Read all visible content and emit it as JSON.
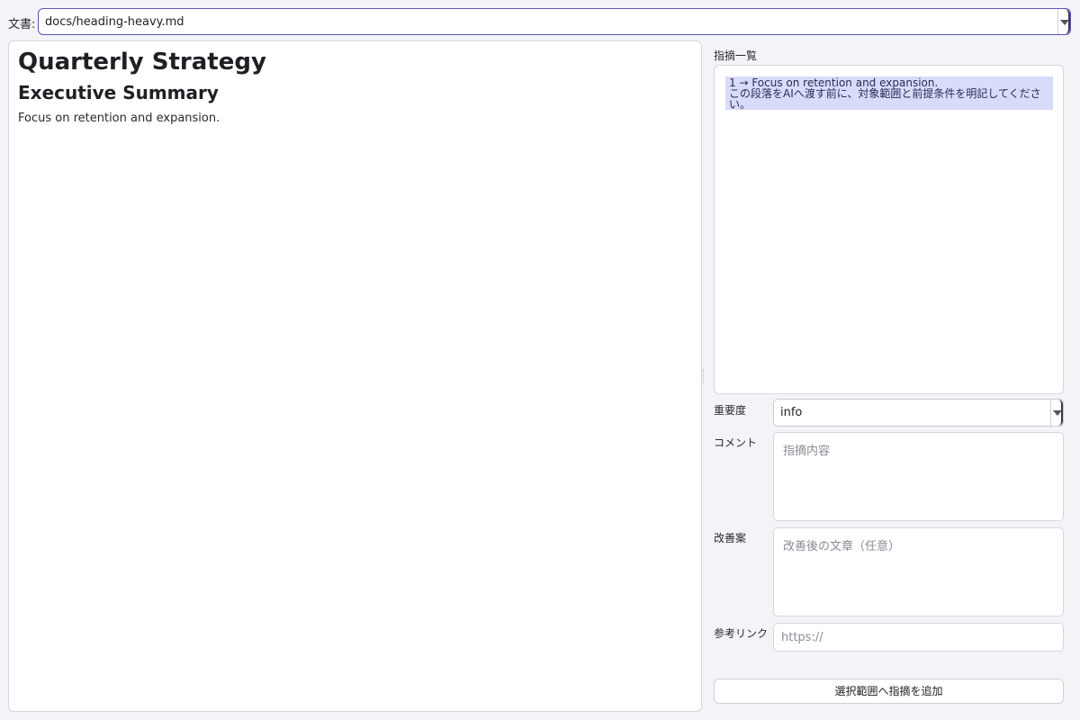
{
  "header": {
    "doc_label": "文書:",
    "doc_value": "docs/heading-heavy.md"
  },
  "editor": {
    "h1": "Quarterly Strategy",
    "h2": "Executive Summary",
    "paragraph": "Focus on retention and expansion."
  },
  "side": {
    "list_label": "指摘一覧",
    "items": [
      {
        "line1": "1 → Focus on retention and expansion.",
        "line2": "この段落をAIへ渡す前に、対象範囲と前提条件を明記してください。"
      }
    ],
    "severity_label": "重要度",
    "severity_value": "info",
    "comment_label": "コメント",
    "comment_placeholder": "指摘内容",
    "suggestion_label": "改善案",
    "suggestion_placeholder": "改善後の文章（任意）",
    "link_label": "参考リンク",
    "link_placeholder": "https://",
    "add_button": "選択範囲へ指摘を追加"
  }
}
